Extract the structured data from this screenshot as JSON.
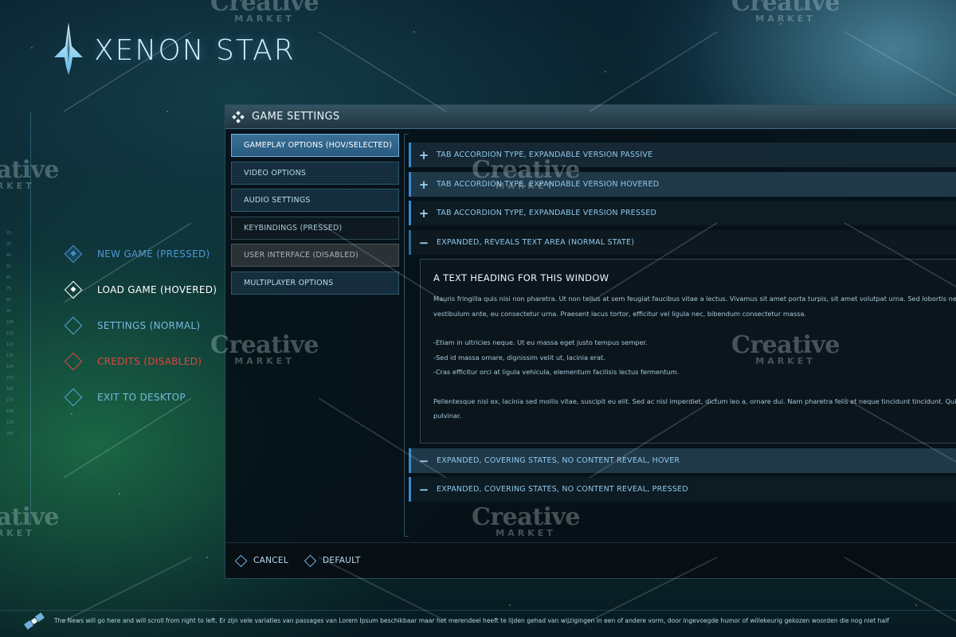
{
  "app": {
    "title": "XENON STAR"
  },
  "ruler": {
    "ticks": [
      "25",
      "35",
      "45",
      "55",
      "65",
      "75",
      "85",
      "95",
      "105",
      "115",
      "125",
      "135",
      "145",
      "155",
      "165",
      "175",
      "185",
      "195",
      "205"
    ]
  },
  "main_menu": {
    "items": [
      {
        "label": "NEW GAME (PRESSED)",
        "state": "pressed"
      },
      {
        "label": "LOAD GAME (HOVERED)",
        "state": "hovered"
      },
      {
        "label": "SETTINGS (NORMAL)",
        "state": "normal"
      },
      {
        "label": "CREDITS (DISABLED)",
        "state": "disabled"
      },
      {
        "label": "EXIT TO DESKTOP",
        "state": "normal"
      }
    ]
  },
  "settings": {
    "title": "GAME SETTINGS",
    "tabs": [
      {
        "label": "GAMEPLAY OPTIONS (HOV/SELECTED)",
        "state": "selected"
      },
      {
        "label": "VIDEO OPTIONS",
        "state": "normal"
      },
      {
        "label": "AUDIO SETTINGS",
        "state": "normal"
      },
      {
        "label": "KEYBINDINGS (PRESSED)",
        "state": "pressed"
      },
      {
        "label": "USER INTERFACE (DISABLED)",
        "state": "disabled"
      },
      {
        "label": "MULTIPLAYER OPTIONS",
        "state": "normal"
      }
    ],
    "accordions": [
      {
        "sign": "+",
        "label": "TAB ACCORDION TYPE, EXPANDABLE VERSION PASSIVE",
        "state": "passive"
      },
      {
        "sign": "+",
        "label": "TAB ACCORDION TYPE, EXPANDABLE VERSION HOVERED",
        "state": "hovered"
      },
      {
        "sign": "+",
        "label": "TAB ACCORDION TYPE, EXPANDABLE VERSION PRESSED",
        "state": "pressed"
      },
      {
        "sign": "−",
        "label": "EXPANDED, REVEALS TEXT AREA (NORMAL STATE)",
        "state": "expanded"
      },
      {
        "sign": "−",
        "label": "EXPANDED, COVERING STATES, NO CONTENT REVEAL, HOVER",
        "state": "hovered"
      },
      {
        "sign": "−",
        "label": "EXPANDED, COVERING STATES, NO CONTENT REVEAL, PRESSED",
        "state": "pressed"
      }
    ],
    "text_area": {
      "heading": "A TEXT HEADING FOR THIS WINDOW",
      "para1_line1": "Mauris fringilla quis nisi non pharetra. Ut non tellus at sem feugiat faucibus vitae a lectus. Vivamus sit amet porta turpis, sit amet volutpat urna. Sed lobortis nec vel",
      "para1_line2": "vestibulum ante, eu consectetur urna. Praesent lacus tortor, efficitur vel ligula nec, bibendum consectetur massa.",
      "bullet1": "-Etiam in ultricies neque. Ut eu massa eget justo tempus semper.",
      "bullet2": "-Sed id massa ornare, dignissim velit ut, lacinia erat.",
      "bullet3": "-Cras efficitur orci at ligula vehicula, elementum facilisis lectus fermentum.",
      "para2_line1": "Pellentesque nisl ex, lacinia sed mollis vitae, suscipit eu elit. Sed ac nisl imperdiet, dictum leo a, ornare dui. Nam pharetra felis et neque tincidunt tincidunt. Quisque",
      "para2_line2": "pulvinar."
    },
    "footer": {
      "cancel_label": "CANCEL",
      "default_label": "DEFAULT"
    }
  },
  "ticker": {
    "text": "The News will go here and will scroll from right to left. Er zijn vele variaties van passages van Lorem Ipsum beschikbaar maar het merendeel heeft te lijden gehad van wijzigingen in een of andere vorm, door ingevoegde humor of willekeurig gekozen woorden die nog niet half"
  },
  "watermark": {
    "word": "Creative",
    "sub": "MARKET"
  }
}
